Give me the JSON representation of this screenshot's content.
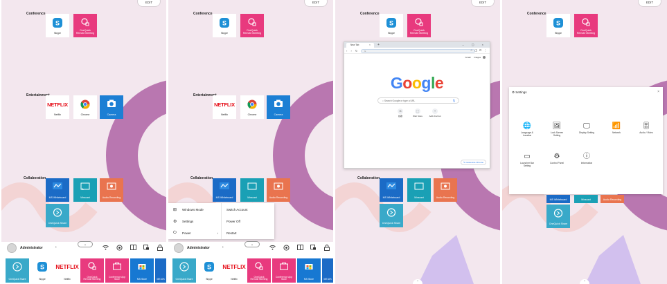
{
  "colors": {
    "skype": "#1e90d6",
    "onequick_meeting": "#e83a7e",
    "camera": "#1c7fd4",
    "ms_whiteboard": "#1b6bc6",
    "miracast": "#1aa0b5",
    "audio_recording": "#e9744f",
    "onequick_share": "#39a9c9",
    "ms_store": "#1778d2",
    "conference_app_store": "#e83a7e"
  },
  "edit_label": "EDIT",
  "sections": {
    "conference": "Conference",
    "entertainment": "Entertainment",
    "collaboration": "Collaboration"
  },
  "apps": {
    "skype": "Skype",
    "onequick_meeting": "OneQuick\nRemote Meeting",
    "netflix_word": "NETFLIX",
    "netflix": "Netflix",
    "chrome": "Chrome",
    "camera": "Camera",
    "ms_whiteboard": "MS Whiteboard",
    "miracast": "Miracast",
    "audio_recording": "Audio Recording",
    "onequick_share": "OneQuick Share",
    "conference_app_store": "Conference App\nStore",
    "ms_store": "MS Store",
    "ms_wh_trunc": "MS Wh"
  },
  "taskbar": {
    "user": "Administrator",
    "arrow": "›",
    "chevron": "⌄"
  },
  "power_menu": {
    "windows_mode": "Windows Mode",
    "settings": "Settings",
    "power": "Power",
    "switch_account": "Switch Account",
    "power_off": "Power Off",
    "restart": "Restart",
    "power_arrow": "‹"
  },
  "chrome": {
    "tab_title": "New Tab",
    "tab_close": "×",
    "new_tab": "+",
    "window_controls": "–  ▢  ×",
    "nav": "‹ › ↻",
    "address": "G",
    "toolbar_icons": "☆ ◫ ⊡ ⋮",
    "gmail": "Gmail",
    "images": "Images",
    "logo_letters": [
      "G",
      "o",
      "o",
      "g",
      "l",
      "e"
    ],
    "logo_colors": [
      "#4285f4",
      "#ea4335",
      "#fbbc05",
      "#4285f4",
      "#34a853",
      "#ea4335"
    ],
    "search_placeholder": "Search Google or type a URL",
    "mic": "🎙",
    "shortcuts": [
      {
        "icon": "G",
        "label": "谷歌"
      },
      {
        "icon": "⬚",
        "label": "Web Store"
      },
      {
        "icon": "+",
        "label": "Add shortcut"
      }
    ],
    "customize": "✎ Customize Chrome"
  },
  "settings": {
    "title": "Settings",
    "close": "×",
    "items": [
      {
        "icon": "🌐",
        "label": "Language &\nLocation"
      },
      {
        "icon": "🖼",
        "label": "Lock Screen\nSetting"
      },
      {
        "icon": "🖵",
        "label": "Display Setting"
      },
      {
        "icon": "📶",
        "label": "Network"
      },
      {
        "icon": "🎚",
        "label": "Audio / Video"
      },
      {
        "icon": "▭",
        "label": "Launcher Bar\nSetting"
      },
      {
        "icon": "⚙",
        "label": "Control Panel"
      },
      {
        "icon": "ⓘ",
        "label": "Information"
      }
    ]
  }
}
